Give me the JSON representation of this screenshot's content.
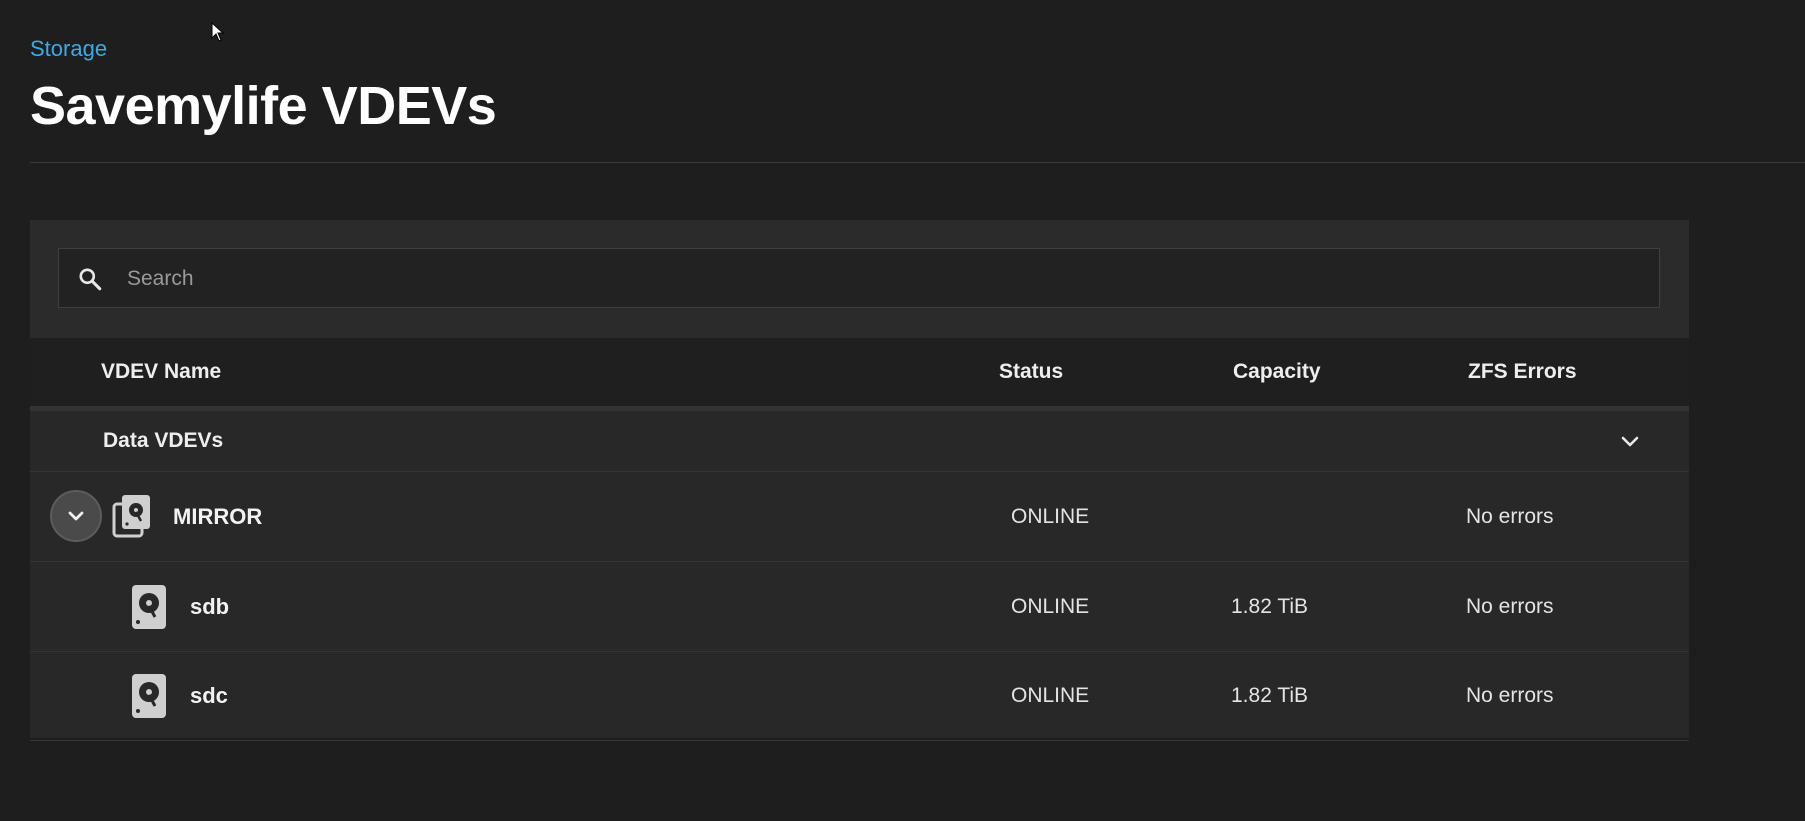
{
  "breadcrumb": {
    "label": "Storage"
  },
  "page": {
    "title": "Savemylife VDEVs"
  },
  "search": {
    "placeholder": "Search",
    "value": ""
  },
  "table": {
    "columns": {
      "name": "VDEV Name",
      "status": "Status",
      "capacity": "Capacity",
      "errors": "ZFS Errors"
    },
    "group": {
      "label": "Data VDEVs"
    },
    "rows": [
      {
        "name": "MIRROR",
        "status": "ONLINE",
        "capacity": "",
        "errors": "No errors",
        "icon": "mirror-disks-icon"
      },
      {
        "name": "sdb",
        "status": "ONLINE",
        "capacity": "1.82 TiB",
        "errors": "No errors",
        "icon": "hard-disk-icon"
      },
      {
        "name": "sdc",
        "status": "ONLINE",
        "capacity": "1.82 TiB",
        "errors": "No errors",
        "icon": "hard-disk-icon"
      }
    ]
  },
  "colors": {
    "background": "#1e1e1e",
    "card": "#282828",
    "accent": "#3fa9e6",
    "text": "#e8e8e8"
  }
}
